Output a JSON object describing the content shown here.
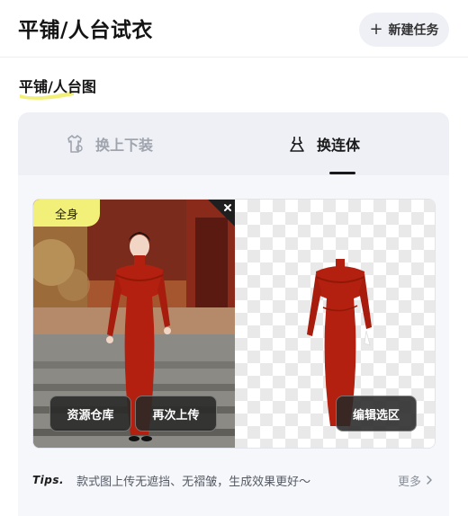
{
  "header": {
    "title": "平铺/人台试衣",
    "new_task_label": "新建任务",
    "new_task_icon": "plus-icon"
  },
  "section": {
    "title": "平铺/人台图"
  },
  "tabs": [
    {
      "label": "换上下装",
      "icon": "shirt-icon",
      "active": false
    },
    {
      "label": "换连体",
      "icon": "dress-icon",
      "active": true
    }
  ],
  "image_panel": {
    "tag": "全身",
    "close_icon": "close-icon",
    "buttons": {
      "repository": "资源仓库",
      "reupload": "再次上传",
      "edit_selection": "编辑选区"
    }
  },
  "tips": {
    "label": "Tips.",
    "text": "款式图上传无遮挡、无褶皱，生成效果更好～",
    "more": "更多",
    "more_icon": "chevron-right-icon"
  },
  "colors": {
    "accent_yellow": "#f3f07a",
    "dress_red": "#b3200f",
    "tab_bg": "#eef0f6",
    "card_bg": "#f6f7fb"
  }
}
